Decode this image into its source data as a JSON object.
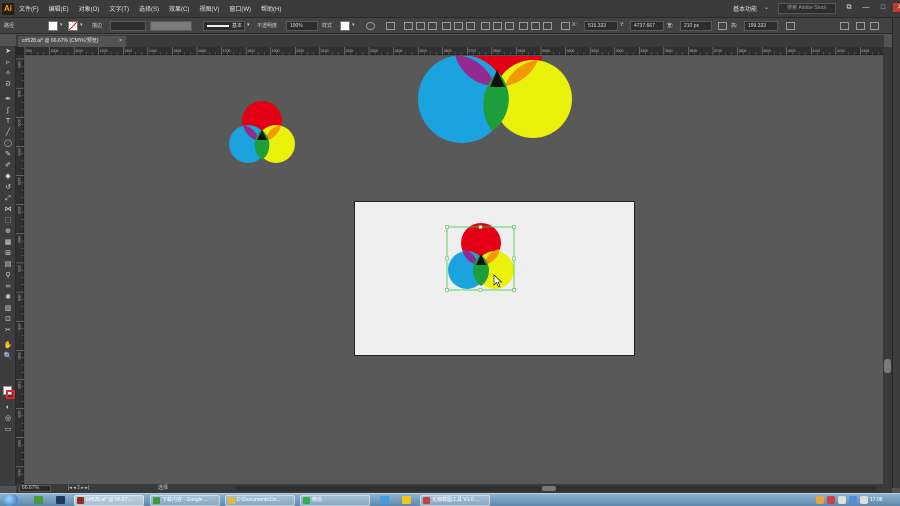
{
  "app": {
    "logo": "Ai",
    "menus": [
      "文件(F)",
      "编辑(E)",
      "对象(O)",
      "文字(T)",
      "选择(S)",
      "效果(C)",
      "视图(V)",
      "窗口(W)",
      "帮助(H)"
    ],
    "workspace": "基本功能",
    "search_placeholder": "搜索 Adobe Stock",
    "window_buttons": [
      "⧉",
      "—",
      "□",
      "✕"
    ]
  },
  "controlbar": {
    "path_label": "路径",
    "stroke_label": "描边",
    "stroke_style": "基本",
    "opacity_label": "不透明度",
    "opacity_value": "100%",
    "style_label": "样式",
    "x_label": "X:",
    "x_value": "515.333",
    "y_label": "Y:",
    "y_value": "4737.667",
    "w_label": "宽:",
    "w_value": "210 px",
    "h_label": "高:",
    "h_value": "199.333"
  },
  "document": {
    "tab_label": "crf528.ai* @ 66.67% (CMYK/预览)",
    "tab_close": "×"
  },
  "rulers": {
    "h_ticks": [
      "900",
      "1000",
      "1100",
      "1200",
      "1300",
      "1400",
      "1500",
      "1600",
      "1700",
      "1800",
      "1900",
      "2000",
      "2100",
      "2200",
      "2300",
      "2400",
      "2500",
      "2600",
      "2700",
      "2800",
      "2900",
      "3000",
      "3100",
      "3200",
      "3300",
      "3400",
      "3500",
      "3600",
      "3700",
      "3800",
      "3900",
      "4000",
      "4100",
      "4200",
      "4300"
    ],
    "v_ticks": [
      "4000",
      "4100",
      "4200",
      "4300",
      "4400",
      "4500",
      "4600",
      "4700",
      "4800",
      "4900",
      "5000",
      "5100",
      "5200",
      "5300",
      "5400"
    ]
  },
  "status": {
    "zoom": "66.67%",
    "page_nav": "|◂  ◂  2  ▸  ▸|",
    "mode": "选择"
  },
  "colors": {
    "red": "#e30016",
    "cyan": "#1aa3de",
    "yellow": "#eaf20c",
    "magenta": "#952a8e",
    "orange": "#f29a00",
    "green": "#1e9e3a",
    "black": "#111111",
    "selection": "#3fc84a",
    "canvas": "#595959",
    "artboard": "#efefef"
  },
  "taskbar": {
    "tasks": [
      {
        "label": "crf528.ai* @ 66.67...",
        "color": "#9a2a15"
      },
      {
        "label": "下载内容 - Google ...",
        "color": "#3b9a3b"
      },
      {
        "label": "D:\\Documents\\Do...",
        "color": "#e8b838"
      },
      {
        "label": "微信",
        "color": "#2bb24c"
      },
      {
        "label": "花瓣截图工具 V1.0 ...",
        "color": "#c64242"
      }
    ],
    "clock": "17:08"
  }
}
